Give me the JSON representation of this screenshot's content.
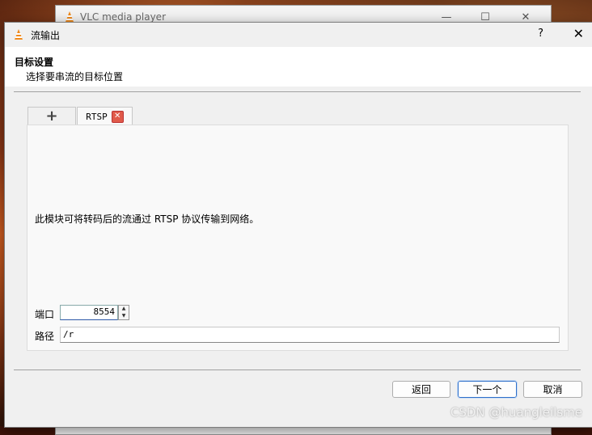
{
  "background_window": {
    "title": "VLC media player",
    "controls": [
      "▶",
      "⏮",
      "■",
      "⏭",
      "⛶",
      "⫶",
      "≡",
      "⟳",
      "✕"
    ]
  },
  "dialog": {
    "title": "流输出",
    "help_label": "?",
    "close_label": "✕",
    "header": {
      "title": "目标设置",
      "subtitle": "选择要串流的目标位置"
    },
    "tabs": [
      {
        "label": "+"
      },
      {
        "label": "RTSP",
        "close": "✕"
      }
    ],
    "description": "此模块可将转码后的流通过 RTSP 协议传输到网络。",
    "port": {
      "label": "端口",
      "value": "8554"
    },
    "path": {
      "label": "路径",
      "value": "/r"
    },
    "buttons": {
      "back": "返回",
      "next": "下一个",
      "cancel": "取消"
    }
  },
  "watermark": "CSDN @huangleilsme",
  "colors": {
    "accent": "#2e6fc9",
    "tab_close": "#e05a4a",
    "vlc_orange": "#f08a1c"
  }
}
